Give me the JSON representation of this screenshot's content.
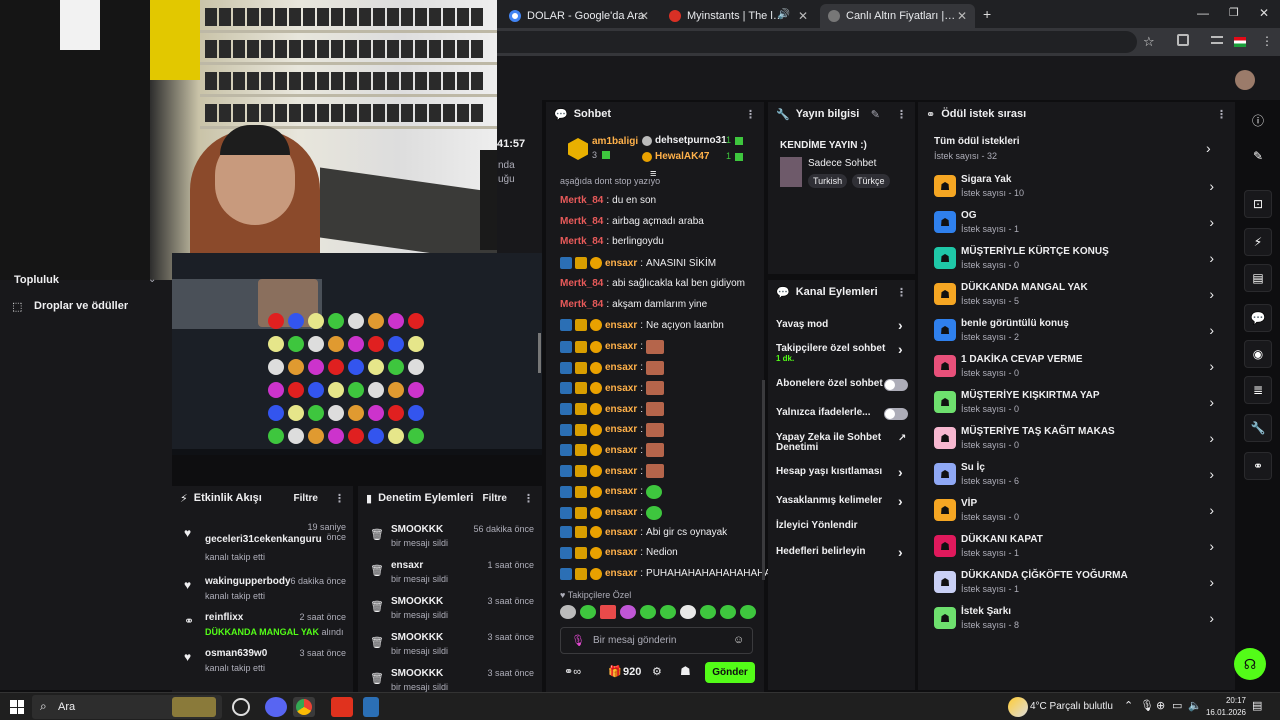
{
  "browser": {
    "tabs": [
      {
        "title": "DOLAR - Google'da Ara",
        "color": "#4285f4"
      },
      {
        "title": "Myinstants | The largest ins",
        "color": "#d93025"
      },
      {
        "title": "Canlı Altın Fiyatları | Harem Altı",
        "color": "#888888"
      }
    ],
    "new_tab": "+"
  },
  "sidebar": {
    "items": [
      "Topluluk",
      "Droplar ve ödüller"
    ],
    "stream_time": "41:57",
    "partial1": "nda",
    "partial2": "uğu"
  },
  "chat": {
    "title": "Sohbet",
    "top_gifters": [
      {
        "name": "am1baligi",
        "count": "3"
      },
      {
        "name": "dehsetpurno31",
        "count": "1"
      },
      {
        "name": "HewalAK47",
        "count": "1"
      }
    ],
    "truncated": "aşağıda dont stop yazıyo",
    "messages": [
      {
        "user": "Mertk_84",
        "text": "du en son"
      },
      {
        "user": "Mertk_84",
        "text": "airbag açmadı araba"
      },
      {
        "user": "Mertk_84",
        "text": "berlingoydu"
      },
      {
        "user": "ensaxr",
        "text": "ANASINI SİKİM"
      },
      {
        "user": "Mertk_84",
        "text": "abi sağlıcakla kal ben gidiyom"
      },
      {
        "user": "Mertk_84",
        "text": "akşam damlarım yine"
      },
      {
        "user": "ensaxr",
        "text": "Ne açıyon laanbn"
      },
      {
        "user": "ensaxr",
        "text": ""
      },
      {
        "user": "ensaxr",
        "text": ""
      },
      {
        "user": "ensaxr",
        "text": ""
      },
      {
        "user": "ensaxr",
        "text": ""
      },
      {
        "user": "ensaxr",
        "text": ""
      },
      {
        "user": "ensaxr",
        "text": ""
      },
      {
        "user": "ensaxr",
        "text": ""
      },
      {
        "user": "ensaxr",
        "text": ""
      },
      {
        "user": "ensaxr",
        "text": ""
      },
      {
        "user": "ensaxr",
        "text": "Abi gir cs oynayak"
      },
      {
        "user": "ensaxr",
        "text": "Nedion"
      },
      {
        "user": "ensaxr",
        "text": "PUHAHAHAHAHAHAHAHA"
      }
    ],
    "followers_only": "Takipçilere Özel",
    "input_placeholder": "Bir mesaj gönderin",
    "points": "920",
    "send": "Gönder"
  },
  "stream_info": {
    "title": "Yayın bilgisi",
    "stream_title": "KENDİME YAYIN :)",
    "category": "Sadece Sohbet",
    "tags": [
      "Turkish",
      "Türkçe"
    ]
  },
  "channel_actions": {
    "title": "Kanal Eylemleri",
    "items": [
      {
        "label": "Yavaş mod",
        "kind": "chevron"
      },
      {
        "label": "Takipçilere özel sohbet",
        "sub": "1 dk.",
        "kind": "chevron"
      },
      {
        "label": "Abonelere özel sohbet",
        "kind": "toggle"
      },
      {
        "label": "Yalnızca ifadelerle...",
        "kind": "toggle"
      },
      {
        "label": "Yapay Zeka ile Sohbet Denetimi",
        "kind": "ext"
      },
      {
        "label": "Hesap yaşı kısıtlaması",
        "kind": "chevron"
      },
      {
        "label": "Yasaklanmış kelimeler",
        "kind": "chevron"
      },
      {
        "label": "İzleyici Yönlendir",
        "kind": "none"
      },
      {
        "label": "Hedefleri belirleyin",
        "kind": "chevron"
      }
    ]
  },
  "rewards": {
    "title": "Ödül istek sırası",
    "all": {
      "label": "Tüm ödül istekleri",
      "sub": "İstek sayısı - 32"
    },
    "items": [
      {
        "label": "Sigara Yak",
        "sub": "İstek sayısı - 10",
        "color": "#f5a623"
      },
      {
        "label": "OG",
        "sub": "İstek sayısı - 1",
        "color": "#2f80ed"
      },
      {
        "label": "MÜŞTERİYLE KÜRTÇE KONUŞ",
        "sub": "İstek sayısı - 0",
        "color": "#1fc8a8"
      },
      {
        "label": "DÜKKANDA MANGAL YAK",
        "sub": "İstek sayısı - 5",
        "color": "#f5a623"
      },
      {
        "label": "benle görüntülü konuş",
        "sub": "İstek sayısı - 2",
        "color": "#2f80ed"
      },
      {
        "label": "1 DAKİKA CEVAP VERME",
        "sub": "İstek sayısı - 0",
        "color": "#e8507a"
      },
      {
        "label": "MÜŞTERİYE KIŞKIRTMA YAP",
        "sub": "İstek sayısı - 0",
        "color": "#6ee06e"
      },
      {
        "label": "MÜŞTERİYE TAŞ KAĞIT MAKAS",
        "sub": "İstek sayısı - 0",
        "color": "#f7b8d0"
      },
      {
        "label": "Su İç",
        "sub": "İstek sayısı - 6",
        "color": "#8fa8f5"
      },
      {
        "label": "VİP",
        "sub": "İstek sayısı - 0",
        "color": "#f5a623"
      },
      {
        "label": "DÜKKANI KAPAT",
        "sub": "İstek sayısı - 1",
        "color": "#e0195c"
      },
      {
        "label": "DÜKKANDA ÇİĞKÖFTE YOĞURMA",
        "sub": "İstek sayısı - 1",
        "color": "#c9d0f5"
      },
      {
        "label": "İstek Şarkı",
        "sub": "İstek sayısı - 8",
        "color": "#6ee06e"
      }
    ]
  },
  "activity": {
    "title": "Etkinlik Akışı",
    "filter": "Filtre",
    "items": [
      {
        "name": "geceleri31cekenkanguru",
        "sub": "kanalı takip etti",
        "time": "19 saniye önce"
      },
      {
        "name": "wakingupperbody",
        "sub": "kanalı takip etti",
        "time": "6 dakika önce"
      },
      {
        "name": "reinflixx",
        "sub": "DÜKKANDA MANGAL YAK",
        "sub2": "alındı",
        "time": "2 saat önce"
      },
      {
        "name": "osman639w0",
        "sub": "kanalı takip etti",
        "time": "3 saat önce"
      }
    ]
  },
  "moderation": {
    "title": "Denetim Eylemleri",
    "filter": "Filtre",
    "items": [
      {
        "name": "SMOOKKK",
        "sub": "bir mesajı sildi",
        "time": "56 dakika önce"
      },
      {
        "name": "ensaxr",
        "sub": "bir mesajı sildi",
        "time": "1 saat önce"
      },
      {
        "name": "SMOOKKK",
        "sub": "bir mesajı sildi",
        "time": "3 saat önce"
      },
      {
        "name": "SMOOKKK",
        "sub": "bir mesajı sildi",
        "time": "3 saat önce"
      },
      {
        "name": "SMOOKKK",
        "sub": "bir mesajı sildi",
        "time": "3 saat önce"
      }
    ]
  },
  "taskbar": {
    "search": "Ara",
    "weather": "4°C  Parçalı bulutlu",
    "time": "20:17",
    "date": "16.01.2026"
  }
}
